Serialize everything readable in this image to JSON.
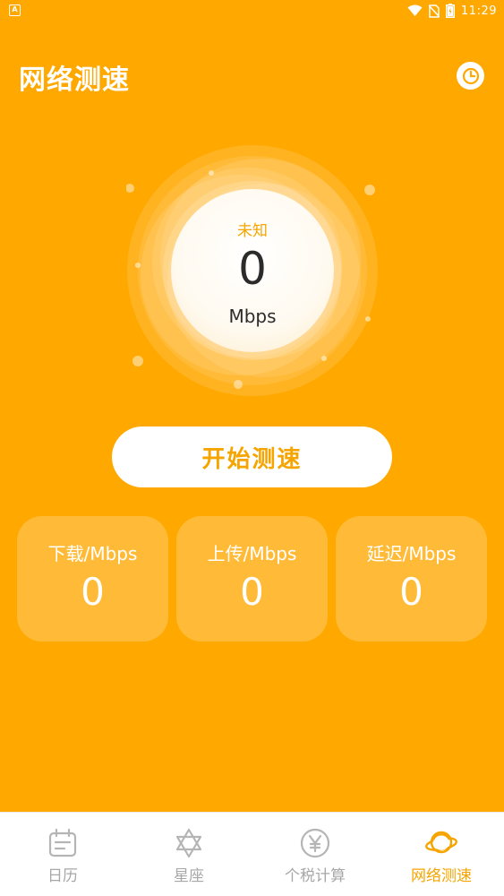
{
  "status_bar": {
    "time": "11:29"
  },
  "header": {
    "title": "网络测速"
  },
  "gauge": {
    "status": "未知",
    "value": "0",
    "unit": "Mbps"
  },
  "start_button": {
    "label": "开始测速"
  },
  "metrics": [
    {
      "label": "下载/Mbps",
      "value": "0"
    },
    {
      "label": "上传/Mbps",
      "value": "0"
    },
    {
      "label": "延迟/Mbps",
      "value": "0"
    }
  ],
  "bottom_nav": {
    "items": [
      {
        "label": "日历",
        "icon": "calendar-icon"
      },
      {
        "label": "星座",
        "icon": "star-of-david-icon"
      },
      {
        "label": "个税计算",
        "icon": "yuan-icon"
      },
      {
        "label": "网络测速",
        "icon": "planet-icon"
      }
    ],
    "active_index": 3
  },
  "colors": {
    "background": "#FFA800",
    "accent": "#F5A400",
    "inactive": "#A7A7A7"
  }
}
